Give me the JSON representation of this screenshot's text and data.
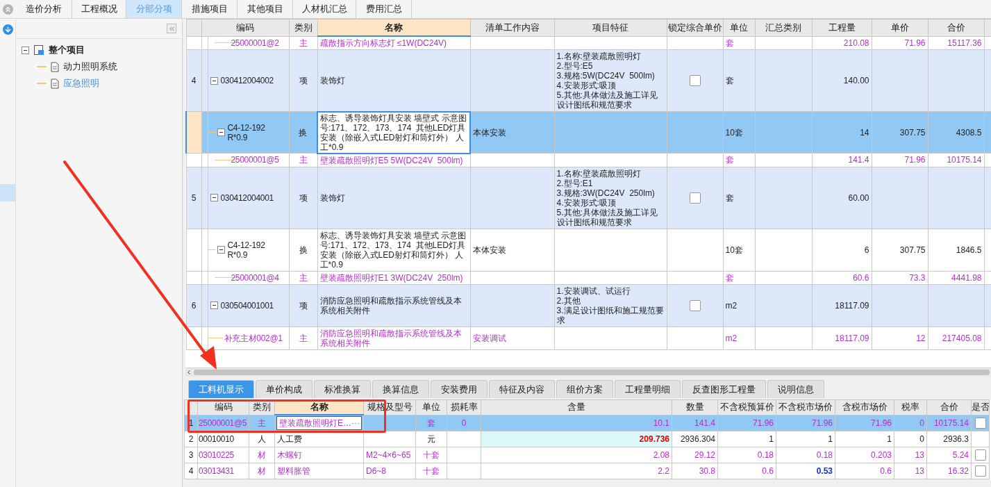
{
  "top_tabs": [
    {
      "label": "造价分析",
      "selected": false
    },
    {
      "label": "工程概况",
      "selected": false
    },
    {
      "label": "分部分项",
      "selected": true
    },
    {
      "label": "措施项目",
      "selected": false
    },
    {
      "label": "其他项目",
      "selected": false
    },
    {
      "label": "人材机汇总",
      "selected": false
    },
    {
      "label": "费用汇总",
      "selected": false
    }
  ],
  "tree": {
    "label": "整个项目",
    "expanded": true,
    "children": [
      {
        "label": "动力照明系统",
        "selected": false
      },
      {
        "label": "应急照明",
        "selected": true
      }
    ]
  },
  "upper_table": {
    "columns": [
      {
        "label": "编码",
        "selected": false
      },
      {
        "label": "类别",
        "selected": false
      },
      {
        "label": "名称",
        "selected": true
      },
      {
        "label": "清单工作内容",
        "selected": false
      },
      {
        "label": "项目特征",
        "selected": false
      },
      {
        "label": "锁定综合单价",
        "selected": false
      },
      {
        "label": "单位",
        "selected": false
      },
      {
        "label": "汇总类别",
        "selected": false
      },
      {
        "label": "工程量",
        "selected": false
      },
      {
        "label": "单价",
        "selected": false
      },
      {
        "label": "合价",
        "selected": false
      }
    ],
    "rows": [
      {
        "kind": "material",
        "code": "25000001@2",
        "category": "主",
        "name": "疏散指示方向标志灯 ≤1W(DC24V)",
        "unit": "套",
        "quantity": "210.08",
        "price": "71.96",
        "total": "15117.36",
        "selected": false
      },
      {
        "kind": "item",
        "number": "4",
        "code": "030412004002",
        "category": "项",
        "name": "装饰灯",
        "features": "1.名称:壁装疏散照明灯\n2.型号:E5\n3.规格:5W(DC24V  500lm)\n4.安装形式:吸顶\n5.其他:具体做法及施工详见设计图纸和规范要求",
        "locked": false,
        "unit": "套",
        "quantity": "140.00",
        "expanded": true,
        "selected": false,
        "children": [
          {
            "kind": "norm",
            "code": "C4-12-192\nR*0.9",
            "category": "换",
            "name": "标志、诱导装饰灯具安装 墙壁式 示意图号:171、172、173、174  其他LED灯具安装（除嵌入式LED射灯和筒灯外） 人工*0.9",
            "work": "本体安装",
            "unit": "10套",
            "quantity": "14",
            "price": "307.75",
            "total": "4308.5",
            "expanded": true,
            "selected": true,
            "children": [
              {
                "kind": "material",
                "code": "25000001@5",
                "category": "主",
                "name": "壁装疏散照明灯E5 5W(DC24V  500lm)",
                "unit": "套",
                "quantity": "141.4",
                "price": "71.96",
                "total": "10175.14",
                "selected": false
              }
            ]
          }
        ]
      },
      {
        "kind": "item",
        "number": "5",
        "code": "030412004001",
        "category": "项",
        "name": "装饰灯",
        "features": "1.名称:壁装疏散照明灯\n2.型号:E1\n3.规格:3W(DC24V  250lm)\n4.安装形式:吸顶\n5.其他:具体做法及施工详见设计图纸和规范要求",
        "locked": false,
        "unit": "套",
        "quantity": "60.00",
        "expanded": true,
        "selected": false,
        "children": [
          {
            "kind": "norm",
            "code": "C4-12-192\nR*0.9",
            "category": "换",
            "name": "标志、诱导装饰灯具安装 墙壁式 示意图号:171、172、173、174  其他LED灯具安装（除嵌入式LED射灯和筒灯外） 人工*0.9",
            "work": "本体安装",
            "unit": "10套",
            "quantity": "6",
            "price": "307.75",
            "total": "1846.5",
            "expanded": true,
            "selected": false,
            "children": [
              {
                "kind": "material",
                "code": "25000001@4",
                "category": "主",
                "name": "壁装疏散照明灯E1 3W(DC24V  250lm)",
                "unit": "套",
                "quantity": "60.6",
                "price": "73.3",
                "total": "4441.98",
                "selected": false
              }
            ]
          }
        ]
      },
      {
        "kind": "item",
        "number": "6",
        "code": "030504001001",
        "category": "项",
        "name": "消防应急照明和疏散指示系统管线及本系统相关附件",
        "features": "1.安装调试、试运行\n2.其他\n3.满足设计图纸和施工规范要求",
        "locked": false,
        "unit": "m2",
        "quantity": "18117.09",
        "expanded": true,
        "selected": false,
        "children": [
          {
            "kind": "material",
            "code": "补充主材002@1",
            "category": "主",
            "name": "消防应急照明和疏散指示系统管线及本系统相关附件",
            "work": "安装调试",
            "unit": "m2",
            "quantity": "18117.09",
            "price": "12",
            "total": "217405.08",
            "selected": false
          }
        ]
      }
    ]
  },
  "bottom_tabs": [
    {
      "label": "工料机显示",
      "selected": true
    },
    {
      "label": "单价构成",
      "selected": false
    },
    {
      "label": "标准换算",
      "selected": false
    },
    {
      "label": "换算信息",
      "selected": false
    },
    {
      "label": "安装费用",
      "selected": false
    },
    {
      "label": "特征及内容",
      "selected": false
    },
    {
      "label": "组价方案",
      "selected": false
    },
    {
      "label": "工程量明细",
      "selected": false
    },
    {
      "label": "反查图形工程量",
      "selected": false
    },
    {
      "label": "说明信息",
      "selected": false
    }
  ],
  "resource_table": {
    "columns": [
      {
        "label": "编码",
        "selected": false
      },
      {
        "label": "类别",
        "selected": false
      },
      {
        "label": "名称",
        "selected": true
      },
      {
        "label": "规格及型号",
        "selected": false
      },
      {
        "label": "单位",
        "selected": false
      },
      {
        "label": "损耗率",
        "selected": false
      },
      {
        "label": "含量",
        "selected": false
      },
      {
        "label": "数量",
        "selected": false
      },
      {
        "label": "不含税预算价",
        "selected": false
      },
      {
        "label": "不含税市场价",
        "selected": false
      },
      {
        "label": "含税市场价",
        "selected": false
      },
      {
        "label": "税率",
        "selected": false
      },
      {
        "label": "合价",
        "selected": false
      },
      {
        "label": "是否",
        "selected": false
      }
    ],
    "rows": [
      {
        "kind": "main",
        "number": "1",
        "code": "25000001@5",
        "category": "主",
        "name": "壁装疏散照明灯E…",
        "browse": "···",
        "unit": "套",
        "loss_rate": "0",
        "ratio": "10.1",
        "quantity": "141.4",
        "budget_price": "71.96",
        "market_price": "71.96",
        "tax_market_price": "71.96",
        "tax_rate": "0",
        "total": "10175.14",
        "checked": false,
        "ratio_changed": false,
        "price_changed": false,
        "selected": true
      },
      {
        "kind": "labor",
        "number": "2",
        "code": "00010010",
        "category": "人",
        "name": "人工费",
        "unit": "元",
        "ratio": "209.736",
        "quantity": "2936.304",
        "budget_price": "1",
        "market_price": "1",
        "tax_market_price": "1",
        "tax_rate": "0",
        "total": "2936.3",
        "ratio_changed": true,
        "price_changed": false,
        "selected": false
      },
      {
        "kind": "material",
        "number": "3",
        "code": "03010225",
        "category": "材",
        "name": "木螺钉",
        "spec": "M2~4×6~65",
        "unit": "十套",
        "ratio": "2.08",
        "quantity": "29.12",
        "budget_price": "0.18",
        "market_price": "0.18",
        "tax_market_price": "0.203",
        "tax_rate": "13",
        "total": "5.24",
        "checked": false,
        "ratio_changed": false,
        "price_changed": false,
        "selected": false
      },
      {
        "kind": "material",
        "number": "4",
        "code": "03013431",
        "category": "材",
        "name": "塑料胀管",
        "spec": "D6~8",
        "unit": "十套",
        "ratio": "2.2",
        "quantity": "30.8",
        "budget_price": "0.6",
        "market_price": "0.53",
        "tax_market_price": "0.6",
        "tax_rate": "13",
        "total": "16.32",
        "checked": false,
        "ratio_changed": false,
        "price_changed": true,
        "selected": false
      }
    ]
  }
}
